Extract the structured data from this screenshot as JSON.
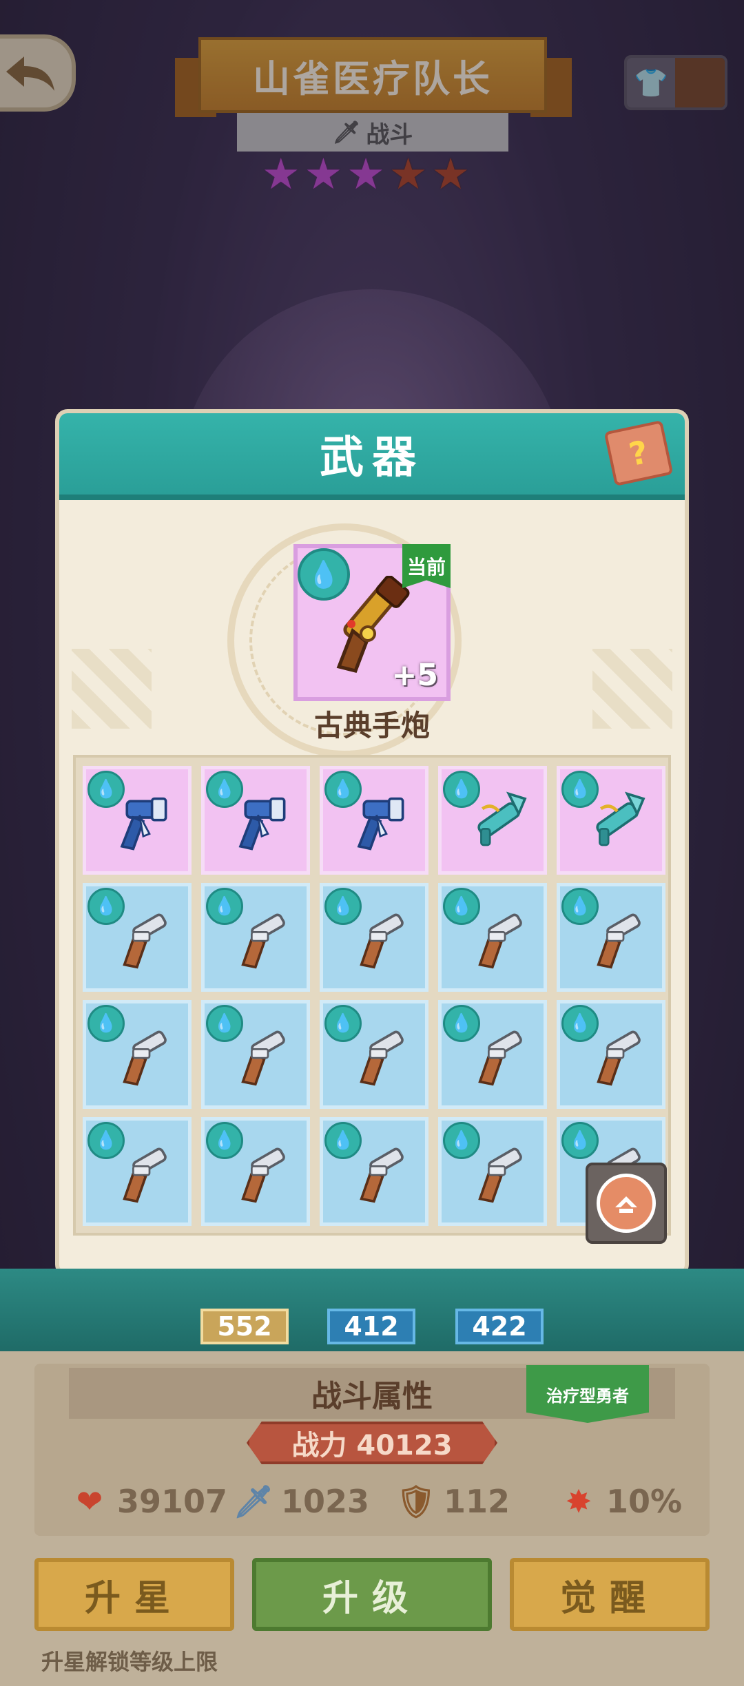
{
  "header": {
    "title": "山雀医疗队长",
    "role": "战斗",
    "stars_total": 5,
    "stars_filled": 3
  },
  "modal": {
    "title": "武器",
    "current": {
      "tag": "当前",
      "enhance": "+5",
      "name": "古典手炮"
    },
    "grid": [
      {
        "rarity": "purple",
        "weapon": "gatling-gun-icon"
      },
      {
        "rarity": "purple",
        "weapon": "gatling-gun-icon"
      },
      {
        "rarity": "purple",
        "weapon": "gatling-gun-icon"
      },
      {
        "rarity": "purple",
        "weapon": "rocket-launcher-icon"
      },
      {
        "rarity": "purple",
        "weapon": "rocket-launcher-icon"
      },
      {
        "rarity": "blue",
        "weapon": "flintlock-pistol-icon"
      },
      {
        "rarity": "blue",
        "weapon": "flintlock-pistol-icon"
      },
      {
        "rarity": "blue",
        "weapon": "flintlock-pistol-icon"
      },
      {
        "rarity": "blue",
        "weapon": "flintlock-pistol-icon"
      },
      {
        "rarity": "blue",
        "weapon": "flintlock-pistol-icon"
      },
      {
        "rarity": "blue",
        "weapon": "flintlock-pistol-icon"
      },
      {
        "rarity": "blue",
        "weapon": "flintlock-pistol-icon"
      },
      {
        "rarity": "blue",
        "weapon": "flintlock-pistol-icon"
      },
      {
        "rarity": "blue",
        "weapon": "flintlock-pistol-icon"
      },
      {
        "rarity": "blue",
        "weapon": "flintlock-pistol-icon"
      },
      {
        "rarity": "blue",
        "weapon": "flintlock-pistol-icon"
      },
      {
        "rarity": "blue",
        "weapon": "flintlock-pistol-icon"
      },
      {
        "rarity": "blue",
        "weapon": "flintlock-pistol-icon"
      },
      {
        "rarity": "blue",
        "weapon": "flintlock-pistol-icon"
      },
      {
        "rarity": "blue",
        "weapon": "flintlock-pistol-icon"
      }
    ]
  },
  "equipment": {
    "weapon_level": "552",
    "armor_level": "412",
    "accessory_level": "422"
  },
  "stats": {
    "title": "战斗属性",
    "type_tag": "治疗型勇者",
    "power": "战力 40123",
    "hp": "39107",
    "attack": "1023",
    "defense": "112",
    "crit": "10%"
  },
  "buttons": {
    "star_up": "升星",
    "level_up": "升级",
    "awaken": "觉醒"
  },
  "hint": "升星解锁等级上限",
  "colors": {
    "teal": "#2a9f98",
    "purple_card": "#f2c2f2",
    "blue_card": "#a8d7ee",
    "gold": "#d8a84b",
    "green": "#6c9a4a"
  }
}
